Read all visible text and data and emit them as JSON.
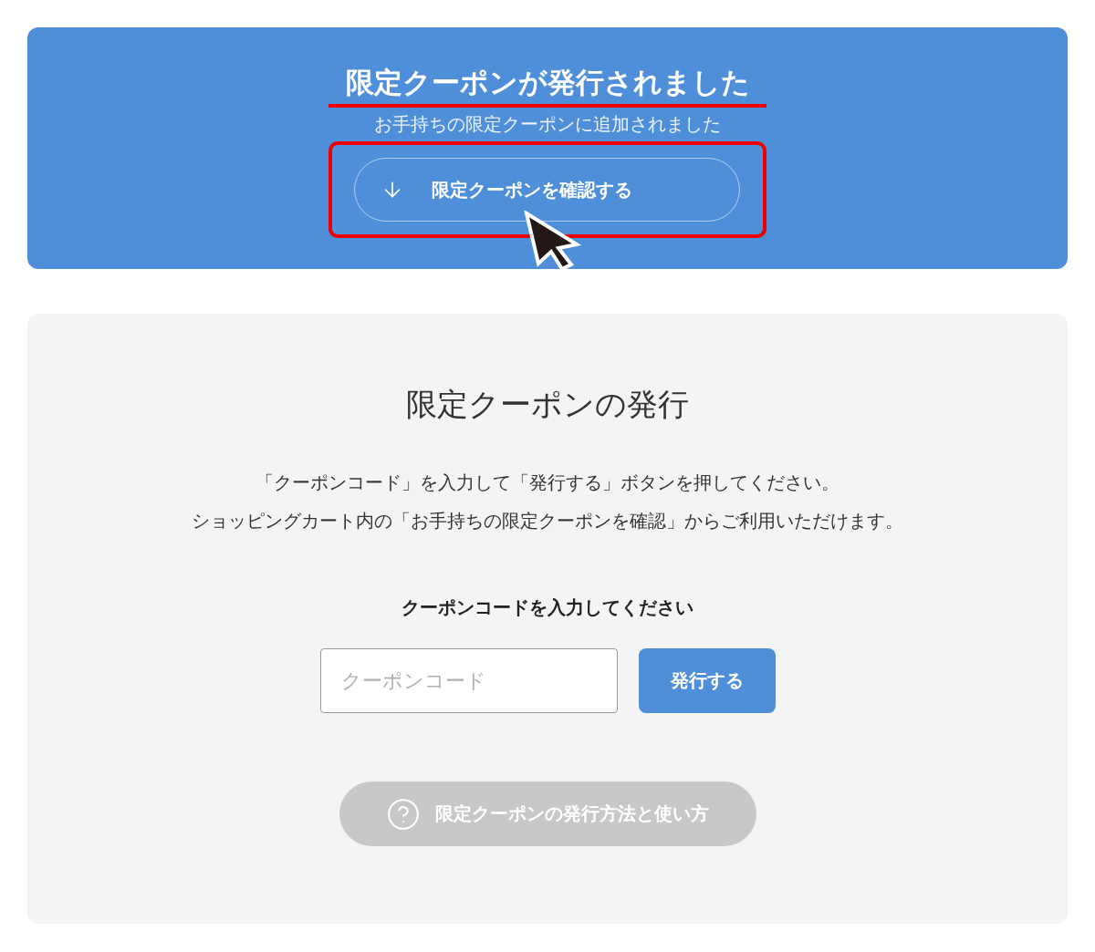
{
  "notice": {
    "title": "限定クーポンが発行されました",
    "title_underlined": true,
    "subtitle": "お手持ちの限定クーポンに追加されました",
    "confirm_button": {
      "label": "限定クーポンを確認する",
      "highlighted": true
    }
  },
  "issue_form": {
    "heading": "限定クーポンの発行",
    "description": [
      "「クーポンコード」を入力して「発行する」ボタンを押してください。",
      "ショッピングカート内の「お手持ちの限定クーポンを確認」からご利用いただけます。"
    ],
    "field_label": "クーポンコードを入力してください",
    "code_field": {
      "placeholder": "クーポンコード"
    },
    "submit_button": {
      "label": "発行する"
    },
    "help_button": {
      "label": "限定クーポンの発行方法と使い方"
    }
  }
}
